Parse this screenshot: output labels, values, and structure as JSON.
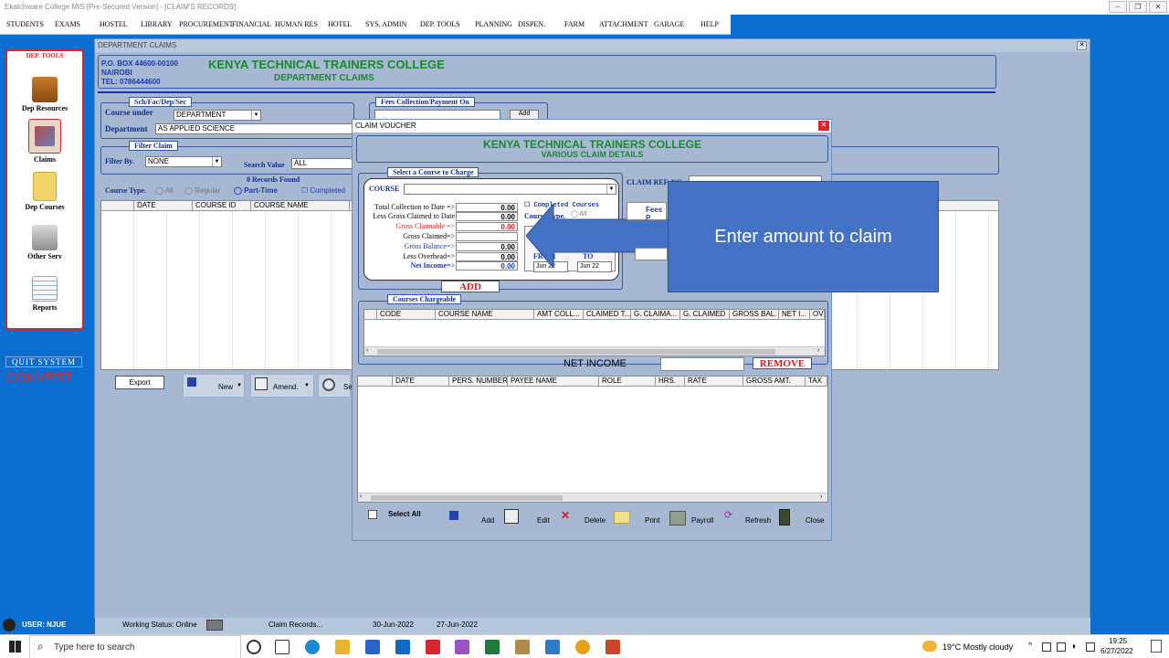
{
  "window_title": "Ekatchware College MIS [Pre-Secured Version] - [CLAIM'S RECORDS]",
  "menu": [
    "STUDENTS",
    "EXAMS",
    "HOSTEL",
    "LIBRARY",
    "PROCUREMENT",
    "FINANCIAL",
    "HUMAN RES",
    "HOTEL",
    "SYS. ADMIN",
    "DEP. TOOLS",
    "PLANNING",
    "DISPEN.",
    "FARM",
    "ATTACHMENT",
    "GARAGE",
    "HELP"
  ],
  "sidebar": {
    "title": "DEP. TOOLS",
    "items": [
      {
        "label": "Dep Resources",
        "icon": "briefcase-icon"
      },
      {
        "label": "Claims",
        "icon": "claims-icon"
      },
      {
        "label": "Dep Courses",
        "icon": "folder-icon"
      },
      {
        "label": "Other Serv",
        "icon": "printer-icon"
      },
      {
        "label": "Reports",
        "icon": "reports-icon"
      }
    ],
    "quit": "QUIT SYSTEM",
    "convert": "CONVERT"
  },
  "main": {
    "caption": "DEPARTMENT CLAIMS",
    "address1": "P.O. BOX 44600-00100",
    "address2": "NAIROBI",
    "address3": "TEL: 0786444600",
    "college": "KENYA TECHNICAL TRAINERS COLLEGE",
    "subtitle": "DEPARTMENT CLAIMS",
    "group_sch": "Sch/Fac/Dep/Sec",
    "course_under_label": "Course under",
    "course_under_value": "DEPARTMENT",
    "department_label": "Department",
    "department_value": "AS APPLIED SCIENCE",
    "group_fees": "Fees Collection/Payment On",
    "add_small": "Add",
    "group_filter": "Filter Claim",
    "filter_by_label": "Filter By.",
    "filter_by_value": "NONE",
    "search_value_label": "Search Value",
    "search_value": "ALL",
    "records_found": "0 Records Found",
    "course_type_label": "Course Type.",
    "radio_all": "All",
    "radio_regular": "Regular",
    "radio_parttime": "Part-Time",
    "check_completed": "Completed",
    "grid_headers": [
      "DATE",
      "COURSE ID",
      "COURSE NAME"
    ],
    "export": "Export",
    "new": "New",
    "amend": "Amend.",
    "search_short": "Se"
  },
  "dialog": {
    "title": "CLAIM VOUCHER",
    "college": "KENYA TECHNICAL TRAINERS COLLEGE",
    "subtitle": "VARIOUS CLAIM DETAILS",
    "group_select": "Select a Course to Charge",
    "claim_ref": "CLAIM REF. NO",
    "course_label": "COURSE",
    "rows": [
      {
        "label": "Total Collection to Date   =>",
        "value": "0.00",
        "color": "#000"
      },
      {
        "label": "Less Gross Claimed to Date",
        "value": "0.00",
        "color": "#000"
      },
      {
        "label": "Gross Claimable =>",
        "value": "0.00",
        "color": "#d02020"
      },
      {
        "label": "Gross Claimed=>",
        "value": "",
        "color": "#000"
      },
      {
        "label": "Gross Balance=>",
        "value": "0.00",
        "color": "#1a3ab0"
      },
      {
        "label": "Less Overhead=>",
        "value": "0.00",
        "color": "#000"
      },
      {
        "label": "Net Income=>",
        "value": "0.00",
        "color": "#1a3ab0"
      }
    ],
    "completed_courses": "Completed Courses",
    "course_type": "Course Type.",
    "radio_all": "All",
    "from": "FROM",
    "to": "TO",
    "from_date": "Jun 22",
    "to_date": "Jun 22",
    "fees_tab": "Fees P",
    "add_big": "ADD",
    "group_chargeable": "Courses Chargeable",
    "charge_headers": [
      "CODE",
      "COURSE NAME",
      "AMT COLL...",
      "CLAIMED T...",
      "G. CLAIMA...",
      "G. CLAIMED",
      "GROSS BAL.",
      "NET I...",
      "OVE"
    ],
    "net_income_label": "NET INCOME",
    "remove": "REMOVE",
    "pay_headers": [
      "DATE",
      "PERS. NUMBER",
      "PAYEE NAME",
      "ROLE",
      "HRS.",
      "RATE",
      "GROSS AMT.",
      "TAX"
    ],
    "select_all": "Select All",
    "buttons": {
      "add": "Add",
      "edit": "Edit",
      "delete": "Delete",
      "print": "Print",
      "payroll": "Payroll",
      "refresh": "Refresh",
      "close": "Close"
    }
  },
  "callout": "Enter amount to claim",
  "status": {
    "user": "USER: NJUE",
    "working": "Working Status: Online",
    "module": "Claim Records...",
    "date1": "30-Jun-2022",
    "date2": "27-Jun-2022"
  },
  "taskbar": {
    "search_placeholder": "Type here to search",
    "weather": "19°C  Mostly cloudy",
    "time": "19:25",
    "date": "6/27/2022"
  }
}
